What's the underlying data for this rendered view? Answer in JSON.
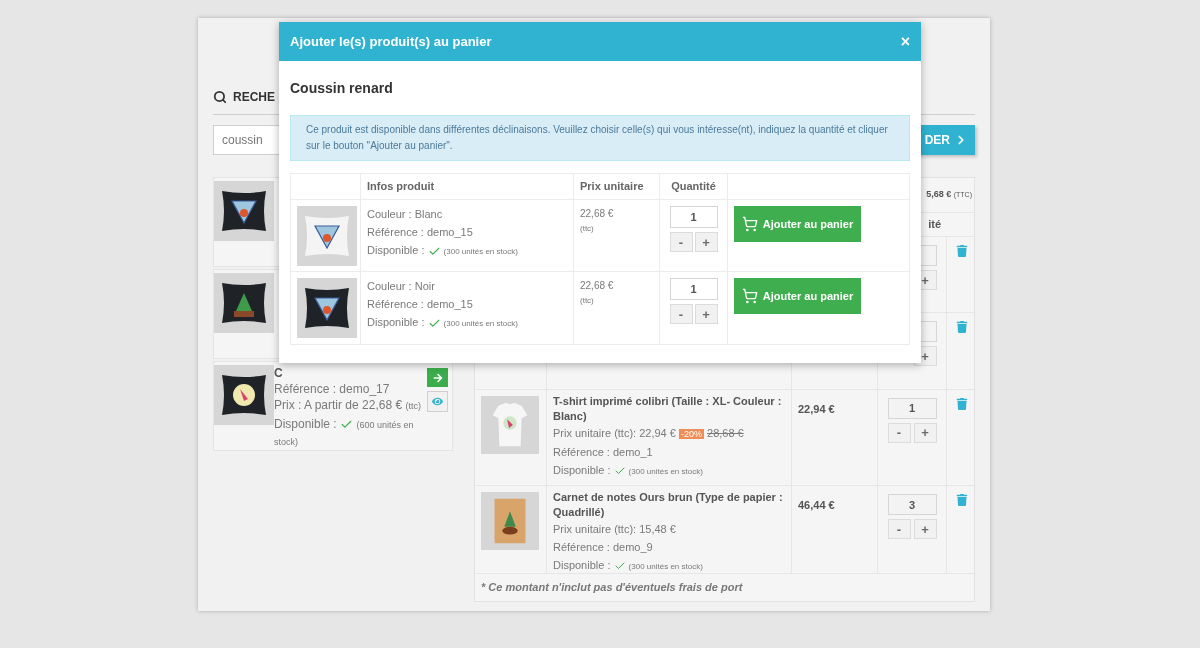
{
  "search": {
    "heading": "RECHE",
    "query": "coussin"
  },
  "results": [
    {
      "kind": "covered"
    },
    {
      "kind": "covered"
    },
    {
      "kind": "full",
      "title": "C",
      "reference": "Référence : demo_17",
      "price": "Prix : A partir de 22,68 €",
      "price_note": "(ttc)",
      "availability": "Disponible :",
      "stock": "(600 unités en stock)"
    }
  ],
  "checkout_button": {
    "label": "DER"
  },
  "cart": {
    "total": "5,68 €",
    "total_note": "(TTC)",
    "qty_header": "ité",
    "minus": "-",
    "plus": "+",
    "rows": [
      {
        "kind": "hidden"
      },
      {
        "kind": "hidden"
      },
      {
        "kind": "full",
        "title": "T-shirt imprimé colibri (Taille : XL- Couleur : Blanc)",
        "unit_price": "Prix unitaire (ttc): 22,94 €",
        "discount": "-20%",
        "old_price": "28,68 €",
        "reference": "Référence : demo_1",
        "availability": "Disponible :",
        "stock": "(300 unités en stock)",
        "price": "22,94 €",
        "quantity": "1"
      },
      {
        "kind": "full",
        "title": "Carnet de notes Ours brun (Type de papier : Quadrillé)",
        "unit_price": "Prix unitaire (ttc): 15,48 €",
        "reference": "Référence : demo_9",
        "availability": "Disponible :",
        "stock": "(300 unités en stock)",
        "price": "46,44 €",
        "quantity": "3"
      }
    ],
    "note": "* Ce montant n'inclut pas d'éventuels frais de port"
  },
  "modal": {
    "title": "Ajouter le(s) produit(s) au panier",
    "close": "×",
    "product": "Coussin renard",
    "info": "Ce produit est disponible dans différentes déclinaisons. Veuillez choisir celle(s) qui vous intéresse(nt), indiquez la quantité et cliquer sur le bouton \"Ajouter au panier\".",
    "columns": {
      "info": "Infos produit",
      "price": "Prix unitaire",
      "quantity": "Quantité"
    },
    "rows": [
      {
        "variant": "Couleur : Blanc",
        "reference": "Référence : demo_15",
        "availability": "Disponible :",
        "stock": "(300 unités en stock)",
        "price": "22,68 €",
        "price_note": "(ttc)",
        "quantity": "1",
        "minus": "-",
        "plus": "+",
        "button": "Ajouter au panier"
      },
      {
        "variant": "Couleur : Noir",
        "reference": "Référence : demo_15",
        "availability": "Disponible :",
        "stock": "(300 unités en stock)",
        "price": "22,68 €",
        "price_note": "(ttc)",
        "quantity": "1",
        "minus": "-",
        "plus": "+",
        "button": "Ajouter au panier"
      }
    ]
  }
}
